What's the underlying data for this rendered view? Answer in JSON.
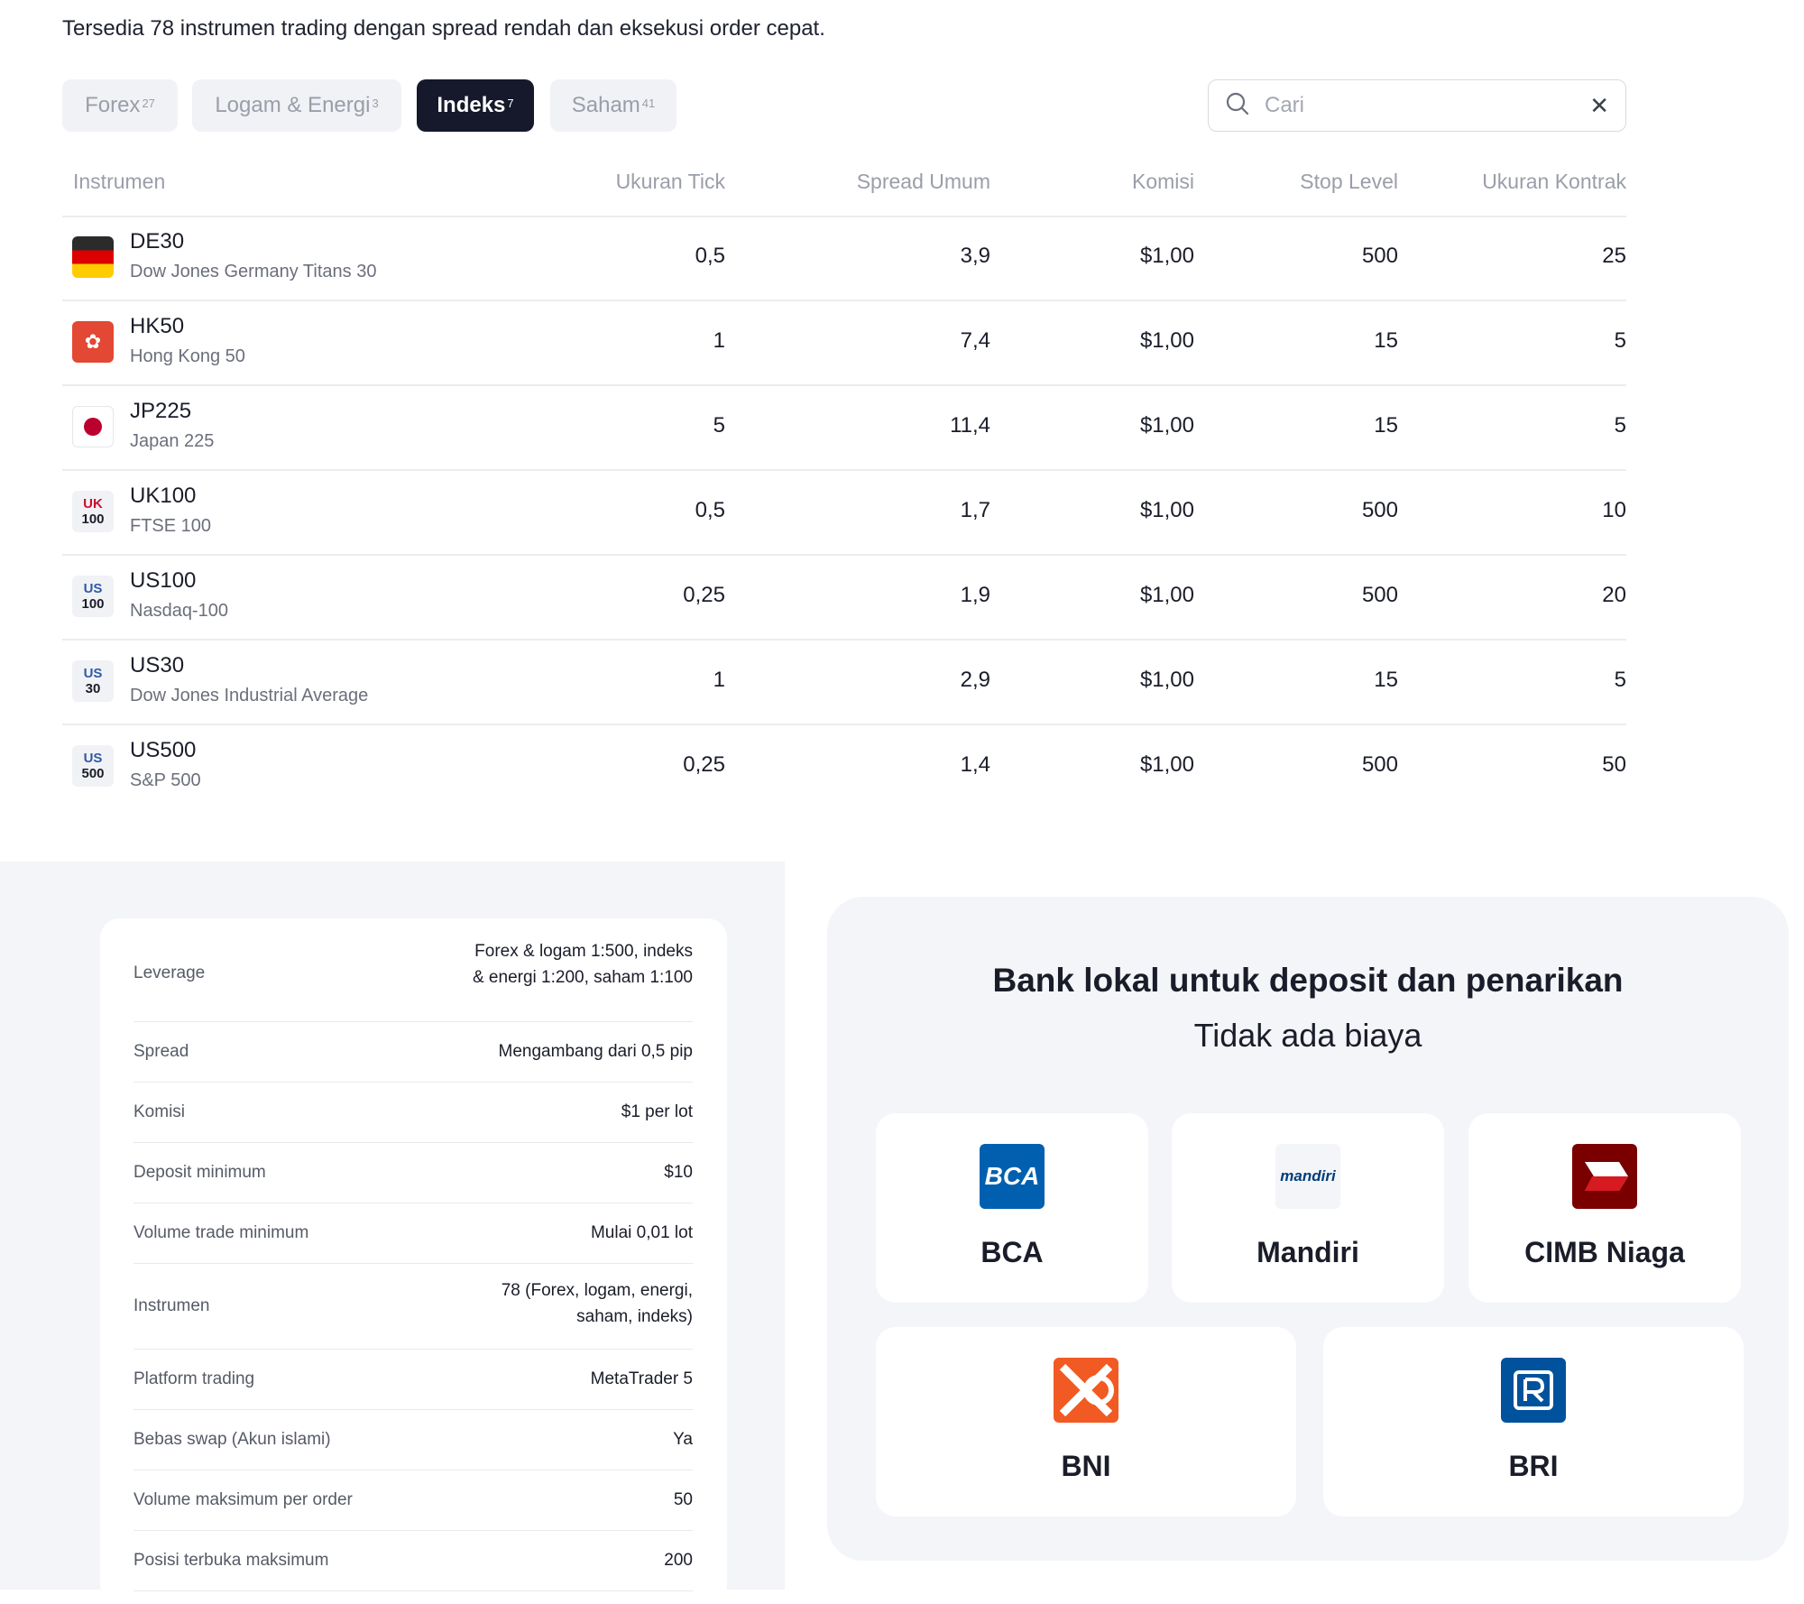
{
  "intro": "Tersedia 78 instrumen trading dengan spread rendah dan eksekusi order cepat.",
  "tabs": [
    {
      "label": "Forex",
      "count": "27"
    },
    {
      "label": "Logam & Energi",
      "count": "3"
    },
    {
      "label": "Indeks",
      "count": "7"
    },
    {
      "label": "Saham",
      "count": "41"
    }
  ],
  "active_tab": "Indeks",
  "search": {
    "placeholder": "Cari",
    "value": "",
    "clear_icon": "close-icon",
    "icon": "search-icon"
  },
  "table": {
    "headers": [
      "Instrumen",
      "Ukuran Tick",
      "Spread Umum",
      "Komisi",
      "Stop Level",
      "Ukuran Kontrak"
    ],
    "rows": [
      {
        "symbol": "DE30",
        "name": "Dow Jones Germany Titans 30",
        "tick": "0,5",
        "spread": "3,9",
        "commission": "$1,00",
        "stop": "500",
        "contract": "25",
        "icon": "germany-flag-icon"
      },
      {
        "symbol": "HK50",
        "name": "Hong Kong 50",
        "tick": "1",
        "spread": "7,4",
        "commission": "$1,00",
        "stop": "15",
        "contract": "5",
        "icon": "hong-kong-flag-icon"
      },
      {
        "symbol": "JP225",
        "name": "Japan 225",
        "tick": "5",
        "spread": "11,4",
        "commission": "$1,00",
        "stop": "15",
        "contract": "5",
        "icon": "japan-flag-icon"
      },
      {
        "symbol": "UK100",
        "name": "FTSE 100",
        "tick": "0,5",
        "spread": "1,7",
        "commission": "$1,00",
        "stop": "500",
        "contract": "10",
        "icon": "uk100-icon",
        "icon_text": [
          "UK",
          "100"
        ]
      },
      {
        "symbol": "US100",
        "name": "Nasdaq-100",
        "tick": "0,25",
        "spread": "1,9",
        "commission": "$1,00",
        "stop": "500",
        "contract": "20",
        "icon": "us100-icon",
        "icon_text": [
          "US",
          "100"
        ]
      },
      {
        "symbol": "US30",
        "name": "Dow Jones Industrial Average",
        "tick": "1",
        "spread": "2,9",
        "commission": "$1,00",
        "stop": "15",
        "contract": "5",
        "icon": "us30-icon",
        "icon_text": [
          "US",
          "30"
        ]
      },
      {
        "symbol": "US500",
        "name": "S&P 500",
        "tick": "0,25",
        "spread": "1,4",
        "commission": "$1,00",
        "stop": "500",
        "contract": "50",
        "icon": "us500-icon",
        "icon_text": [
          "US",
          "500"
        ]
      }
    ]
  },
  "specs": [
    {
      "label": "Leverage",
      "value_lines": [
        "Forex & logam 1:500, indeks",
        "& energi 1:200, saham 1:100"
      ]
    },
    {
      "label": "Spread",
      "value_lines": [
        "Mengambang dari 0,5 pip"
      ]
    },
    {
      "label": "Komisi",
      "value_lines": [
        "$1 per lot"
      ]
    },
    {
      "label": "Deposit minimum",
      "value_lines": [
        "$10"
      ]
    },
    {
      "label": "Volume trade minimum",
      "value_lines": [
        "Mulai 0,01 lot"
      ]
    },
    {
      "label": "Instrumen",
      "value_lines": [
        "78 (Forex, logam, energi,",
        "saham, indeks)"
      ]
    },
    {
      "label": "Platform trading",
      "value_lines": [
        "MetaTrader 5"
      ]
    },
    {
      "label": "Bebas swap (Akun islami)",
      "value_lines": [
        "Ya"
      ]
    },
    {
      "label": "Volume maksimum per order",
      "value_lines": [
        "50"
      ]
    },
    {
      "label": "Posisi terbuka maksimum",
      "value_lines": [
        "200"
      ]
    }
  ],
  "banks": {
    "title": "Bank lokal untuk deposit dan penarikan",
    "subtitle": "Tidak ada biaya",
    "items": [
      {
        "name": "BCA",
        "logo_text": "BCA",
        "color": "#0060af"
      },
      {
        "name": "Mandiri",
        "logo_text": "mandiri",
        "color": "#003d79"
      },
      {
        "name": "CIMB Niaga",
        "color": "#7a0000"
      },
      {
        "name": "BNI",
        "color": "#f15a23"
      },
      {
        "name": "BRI",
        "color": "#00529c"
      }
    ]
  }
}
